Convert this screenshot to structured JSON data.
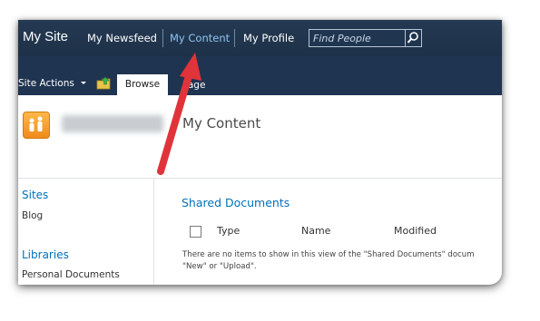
{
  "topbar": {
    "site_title": "My Site",
    "nav": [
      "My Newsfeed",
      "My Content",
      "My Profile"
    ],
    "search_placeholder": "Find People"
  },
  "ribbon": {
    "site_actions": "Site Actions",
    "tabs": [
      "Browse",
      "Page"
    ]
  },
  "header": {
    "page_title": "My Content"
  },
  "left_nav": {
    "sections": [
      {
        "heading": "Sites",
        "items": [
          "Blog"
        ]
      },
      {
        "heading": "Libraries",
        "items": [
          "Personal Documents"
        ]
      }
    ]
  },
  "list": {
    "title": "Shared Documents",
    "columns": [
      "Type",
      "Name",
      "Modified"
    ],
    "empty_line1": "There are no items to show in this view of the \"Shared Documents\" docum",
    "empty_line2": "\"New\" or \"Upload\"."
  },
  "colors": {
    "topbar": "#1d3148",
    "active_link": "#8fc3f1",
    "link_blue": "#0072bc",
    "annotation_arrow": "#e0343a",
    "logo_orange": "#f08a1c"
  },
  "icons": [
    "search-icon",
    "dropdown-arrow-icon",
    "folder-up-icon",
    "site-logo-icon",
    "annotation-arrow"
  ]
}
